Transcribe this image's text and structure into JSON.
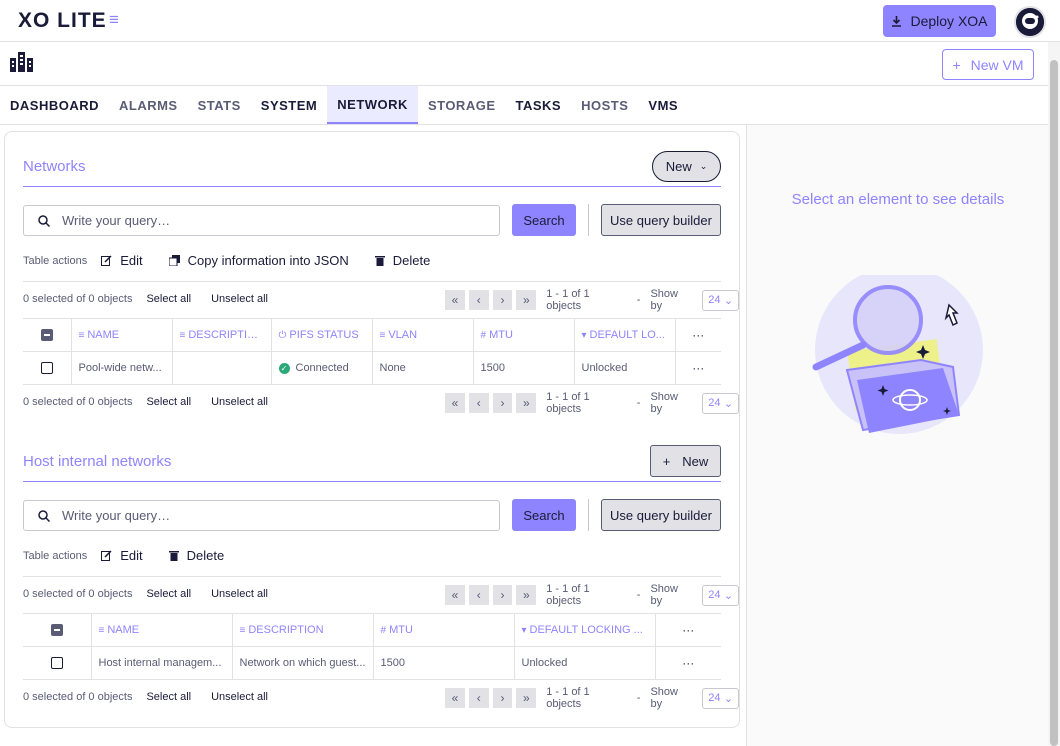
{
  "app": {
    "logo_text": "XO LITE",
    "deploy_label": "Deploy XOA"
  },
  "subbar": {
    "new_vm_label": "New VM"
  },
  "tabs": [
    {
      "label": "DASHBOARD"
    },
    {
      "label": "ALARMS"
    },
    {
      "label": "STATS"
    },
    {
      "label": "SYSTEM"
    },
    {
      "label": "NETWORK"
    },
    {
      "label": "STORAGE"
    },
    {
      "label": "TASKS"
    },
    {
      "label": "HOSTS"
    },
    {
      "label": "VMS"
    }
  ],
  "side": {
    "empty_text": "Select an element to see details"
  },
  "networks": {
    "title": "Networks",
    "new_label": "New",
    "query_placeholder": "Write your query…",
    "search_label": "Search",
    "query_builder_label": "Use query builder",
    "table_actions_label": "Table actions",
    "actions": [
      "Edit",
      "Copy information into JSON",
      "Delete"
    ],
    "selection": {
      "count": "0 selected of 0 objects",
      "select_all": "Select all",
      "unselect_all": "Unselect all"
    },
    "pager": {
      "info": "1 - 1 of 1 objects",
      "show_by_label": "Show by",
      "show_by_value": "24"
    },
    "columns": [
      "NAME",
      "DESCRIPTION",
      "PIFS STATUS",
      "VLAN",
      "MTU",
      "DEFAULT LO..."
    ],
    "rows": [
      {
        "name": "Pool-wide netw...",
        "description": "",
        "pifs_status": "Connected",
        "vlan": "None",
        "mtu": "1500",
        "default_locking": "Unlocked"
      }
    ]
  },
  "host_networks": {
    "title": "Host internal networks",
    "new_label": "New",
    "query_placeholder": "Write your query…",
    "search_label": "Search",
    "query_builder_label": "Use query builder",
    "table_actions_label": "Table actions",
    "actions": [
      "Edit",
      "Delete"
    ],
    "selection": {
      "count": "0 selected of 0 objects",
      "select_all": "Select all",
      "unselect_all": "Unselect all"
    },
    "pager": {
      "info": "1 - 1 of 1 objects",
      "show_by_label": "Show by",
      "show_by_value": "24"
    },
    "columns": [
      "NAME",
      "DESCRIPTION",
      "MTU",
      "DEFAULT LOCKING ..."
    ],
    "rows": [
      {
        "name": "Host internal managem...",
        "description": "Network on which guest...",
        "mtu": "1500",
        "default_locking": "Unlocked"
      }
    ]
  },
  "colors": {
    "accent": "#8f84ff",
    "text": "#1a1b38",
    "muted": "#5a5b75",
    "success": "#2ca878"
  }
}
